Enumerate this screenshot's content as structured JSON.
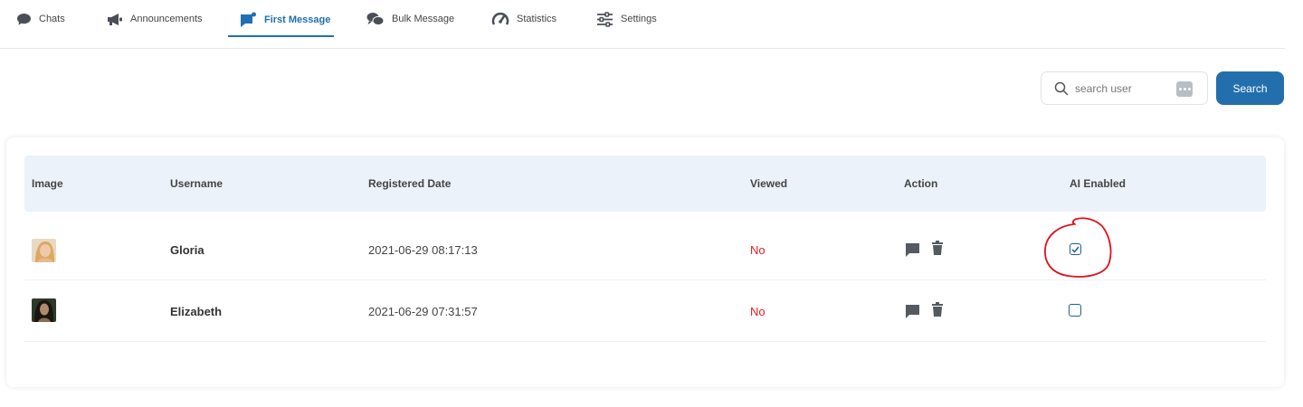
{
  "nav": {
    "tabs": [
      {
        "label": "Chats",
        "icon": "chat-bubble-icon",
        "active": false
      },
      {
        "label": "Announcements",
        "icon": "megaphone-icon",
        "active": false
      },
      {
        "label": "First Message",
        "icon": "flag-message-icon",
        "active": true
      },
      {
        "label": "Bulk Message",
        "icon": "bulk-message-icon",
        "active": false
      },
      {
        "label": "Statistics",
        "icon": "speedometer-icon",
        "active": false
      },
      {
        "label": "Settings",
        "icon": "sliders-icon",
        "active": false
      }
    ]
  },
  "search": {
    "placeholder": "search user",
    "value": "",
    "button_label": "Search"
  },
  "table": {
    "headers": [
      "Image",
      "Username",
      "Registered Date",
      "Viewed",
      "Action",
      "AI Enabled"
    ],
    "rows": [
      {
        "username": "Gloria",
        "registered": "2021-06-29 08:17:13",
        "viewed": "No",
        "ai_enabled": true
      },
      {
        "username": "Elizabeth",
        "registered": "2021-06-29 07:31:57",
        "viewed": "No",
        "ai_enabled": false
      }
    ]
  },
  "colors": {
    "accent": "#1f6fb2",
    "button": "#236fae",
    "header_bg": "#ebf2fa",
    "viewed_no": "#e02020",
    "annotation": "#e0101a"
  }
}
